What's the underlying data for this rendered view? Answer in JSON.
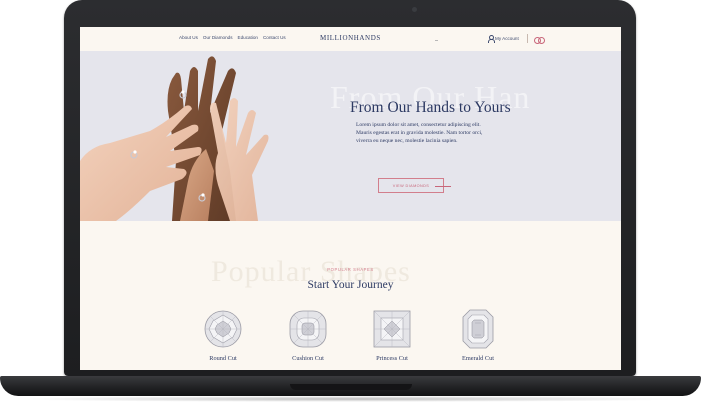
{
  "nav": {
    "links": [
      "About Us",
      "Our Diamonds",
      "Education",
      "Contact Us"
    ],
    "logo": "MILLIONHANDS",
    "account_label": "My Account",
    "icons": [
      "person-icon",
      "rings-icon"
    ]
  },
  "hero": {
    "background_text": "From Our Han",
    "title": "From Our Hands to Yours",
    "body_lines": [
      "Lorem ipsum dolor sit amet, consectetur adipiscing elit.",
      "Mauris egestas erat in gravida molestie. Nam tortor orci,",
      "viverra eu neque nec, molestie lacinia sapien."
    ],
    "button_label": "VIEW DIAMONDS"
  },
  "shapes": {
    "background_text": "Popular Shapes",
    "eyebrow": "POPULAR SHAPES",
    "title": "Start Your Journey",
    "items": [
      {
        "label": "Round Cut",
        "icon": "round-diamond-icon"
      },
      {
        "label": "Cushion Cut",
        "icon": "cushion-diamond-icon"
      },
      {
        "label": "Princess Cut",
        "icon": "princess-diamond-icon"
      },
      {
        "label": "Emerald Cut",
        "icon": "emerald-diamond-icon"
      }
    ]
  },
  "colors": {
    "navy": "#2d3a63",
    "accent_pink": "#d27e8c",
    "hero_bg": "#e5e5ec",
    "page_bg": "#fbf7f1"
  }
}
